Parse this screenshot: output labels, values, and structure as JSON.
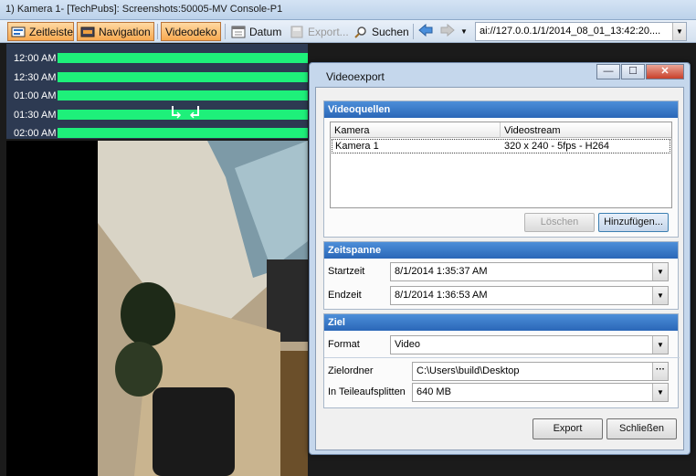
{
  "window": {
    "title": "1) Kamera 1- [TechPubs]: Screenshots:50005-MV Console-P1"
  },
  "toolbar": {
    "zeitleiste": "Zeitleiste",
    "navigation": "Navigation",
    "videodeko": "Videodeko",
    "datum": "Datum",
    "export": "Export...",
    "suchen": "Suchen",
    "address": "ai://127.0.0.1/1/2014_08_01_13:42:20...."
  },
  "timeline": {
    "rows": [
      "12:00 AM",
      "12:30 AM",
      "01:00 AM",
      "01:30 AM",
      "02:00 AM"
    ]
  },
  "dialog": {
    "title": "Videoexport",
    "sources": {
      "header": "Videoquellen",
      "columns": [
        "Kamera",
        "Videostream"
      ],
      "rows": [
        {
          "kamera": "Kamera 1",
          "videostream": "320 x 240 - 5fps - H264"
        }
      ],
      "delete_label": "Löschen",
      "add_label": "Hinzufügen..."
    },
    "timespan": {
      "header": "Zeitspanne",
      "start_label": "Startzeit",
      "start_value": "8/1/2014 1:35:37 AM",
      "end_label": "Endzeit",
      "end_value": "8/1/2014 1:36:53 AM"
    },
    "target": {
      "header": "Ziel",
      "format_label": "Format",
      "format_value": "Video",
      "folder_label": "Zielordner",
      "folder_value": "C:\\Users\\build\\Desktop",
      "split_label": "In Teileaufsplitten",
      "split_value": "640 MB"
    },
    "export_label": "Export",
    "close_label": "Schließen"
  },
  "colors": {
    "timeline_bar": "#1ef07a",
    "section_header": "#2a67b7",
    "active_tab": "#f7a950"
  }
}
